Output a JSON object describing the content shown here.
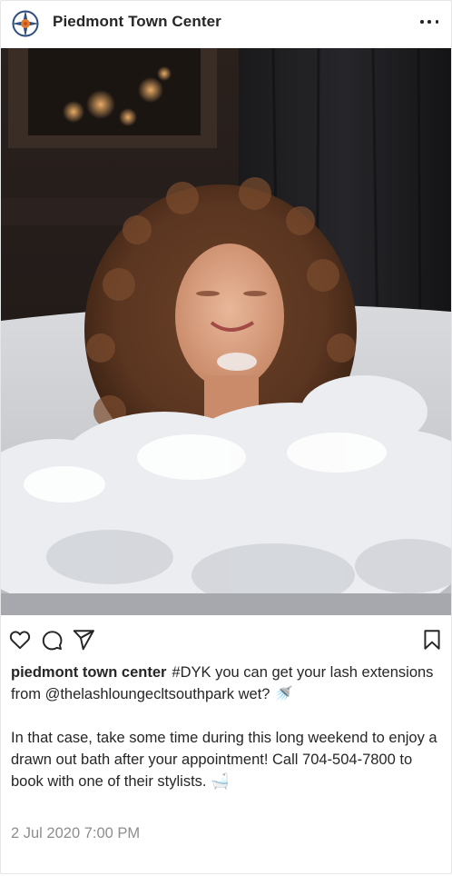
{
  "post": {
    "account_name": "Piedmont Town Center",
    "avatar_icon": "compass-rose-logo",
    "more_icon": "more-options-icon",
    "image_description_icon": "photo",
    "caption_user": "piedmont town center",
    "caption_line1": "#DYK you can get your lash extensions from @thelashloungecltsouthpark wet? 🚿",
    "caption_line2": "In that case, take some time during this long weekend to enjoy a drawn out bath after your appointment! Call 704-504-7800 to book with one of their stylists. 🛁",
    "timestamp": "2 Jul 2020 7:00 PM"
  },
  "actions": {
    "like_icon": "heart-icon",
    "comment_icon": "comment-icon",
    "share_icon": "share-icon",
    "save_icon": "bookmark-icon"
  },
  "colors": {
    "text": "#262626",
    "muted": "#8e8e8e",
    "border": "#e6e6e6",
    "logo_blue": "#2f4f7f",
    "logo_orange": "#e07a2f"
  }
}
